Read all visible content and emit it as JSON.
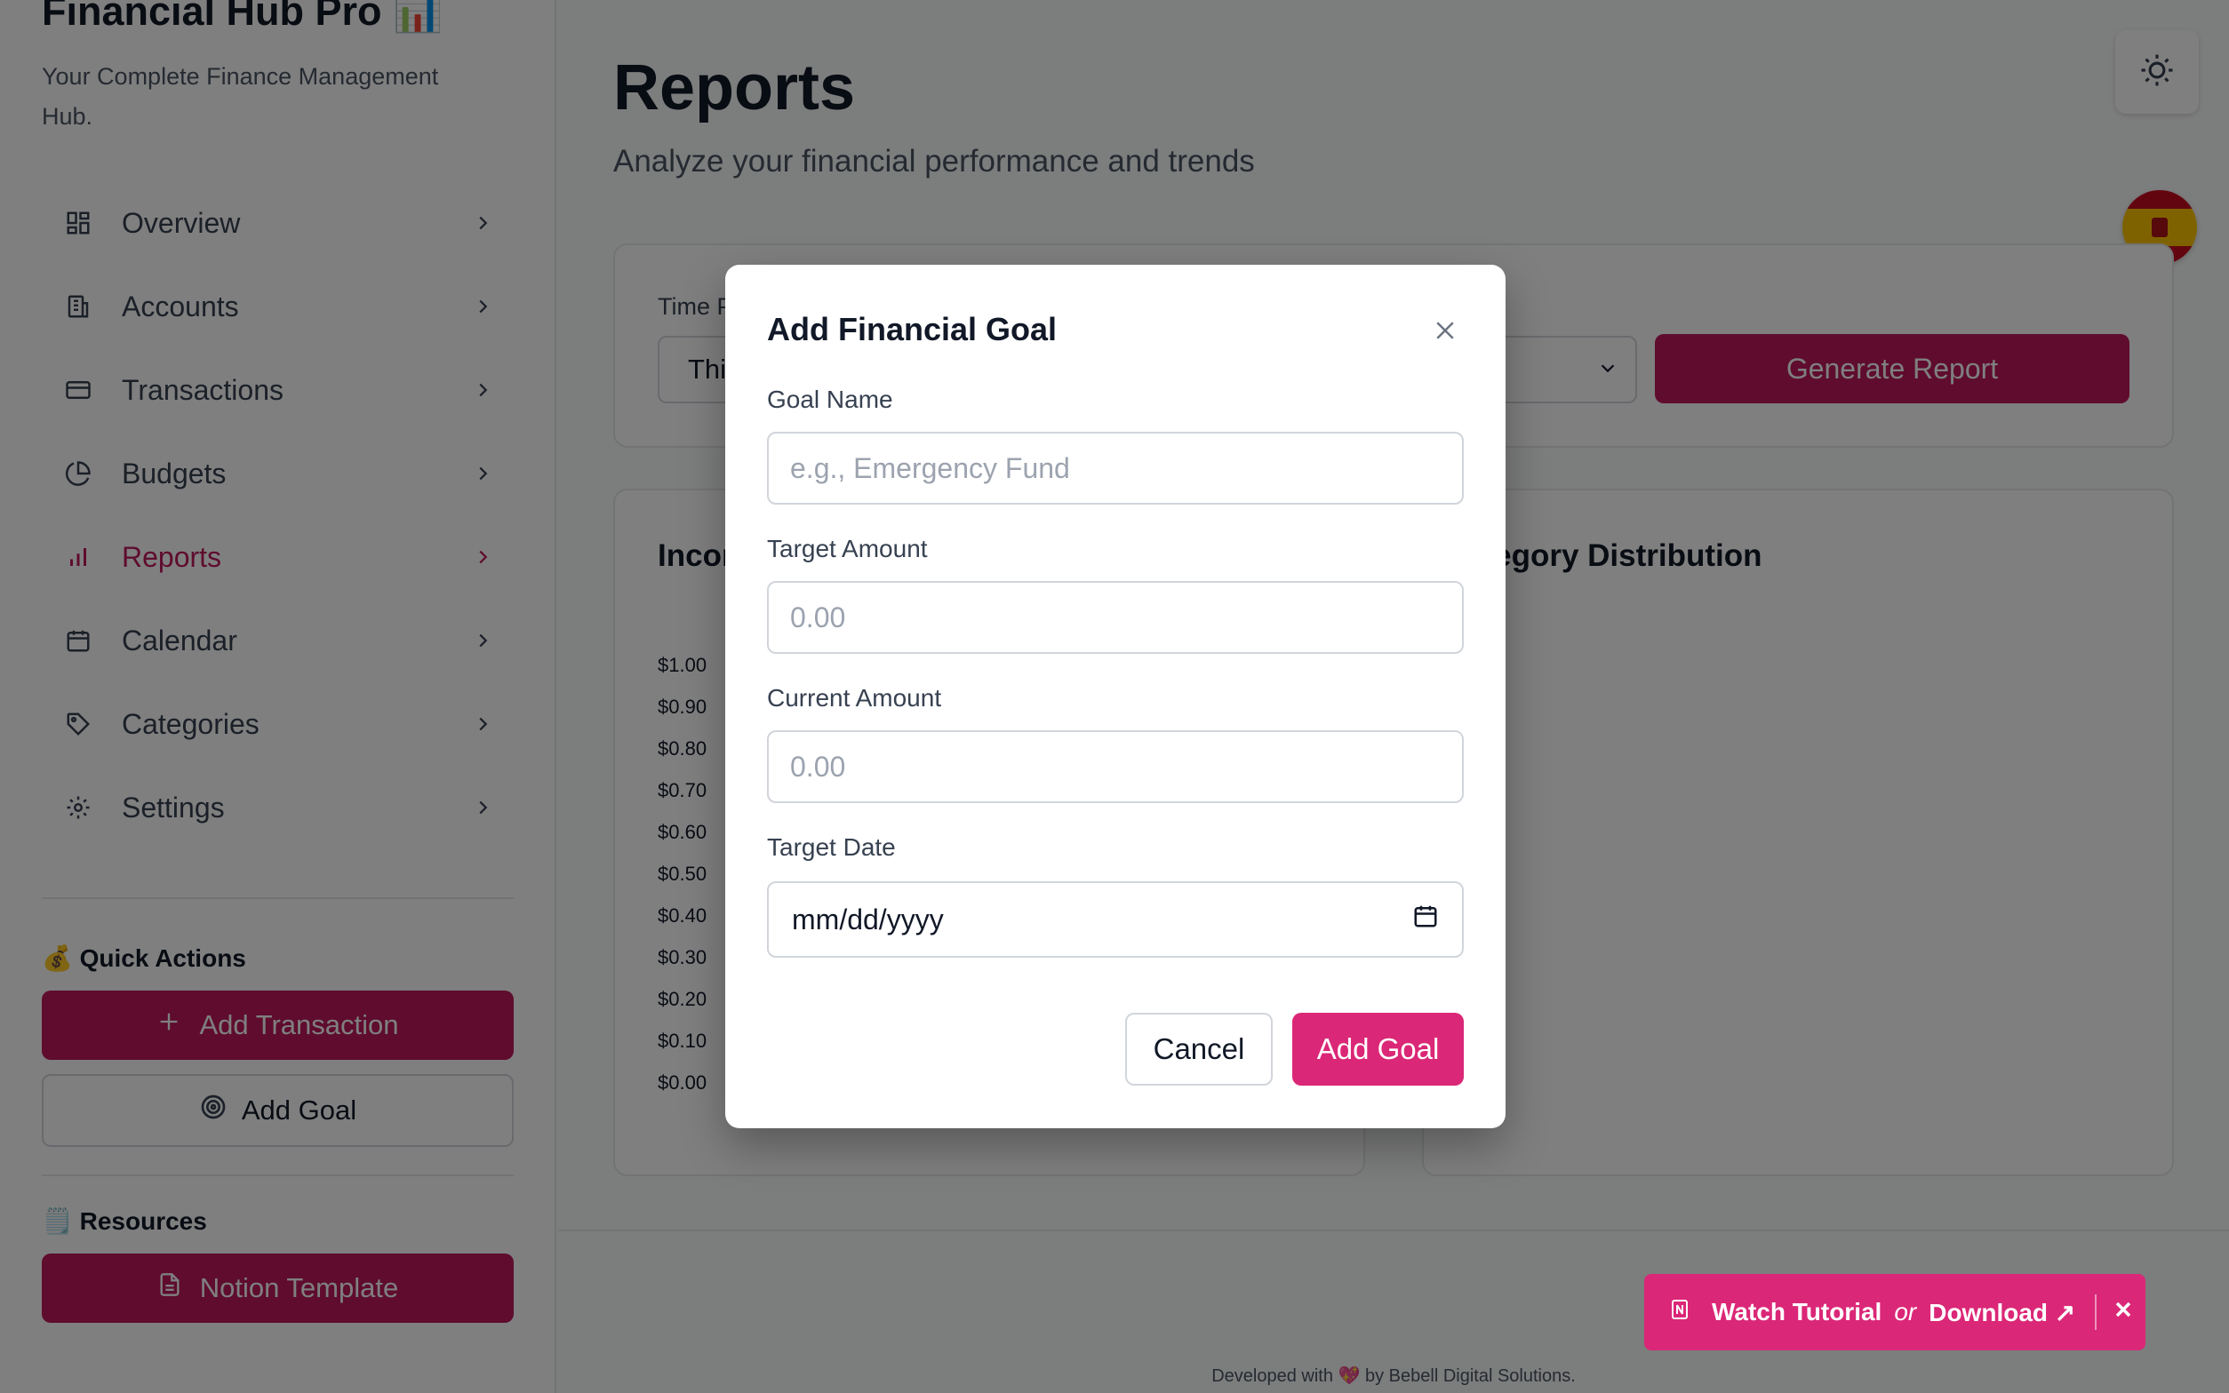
{
  "app": {
    "title": "Financial Hub Pro 📊",
    "subtitle": "Your Complete Finance Management Hub."
  },
  "nav": {
    "items": [
      {
        "label": "Overview",
        "icon": "layout-grid-icon"
      },
      {
        "label": "Accounts",
        "icon": "building-icon"
      },
      {
        "label": "Transactions",
        "icon": "credit-card-icon"
      },
      {
        "label": "Budgets",
        "icon": "pie-chart-icon"
      },
      {
        "label": "Reports",
        "icon": "bar-chart-icon",
        "active": true
      },
      {
        "label": "Calendar",
        "icon": "calendar-icon"
      },
      {
        "label": "Categories",
        "icon": "tag-icon"
      },
      {
        "label": "Settings",
        "icon": "gear-icon"
      }
    ]
  },
  "quick_actions": {
    "title": "💰 Quick Actions",
    "add_transaction": "Add Transaction",
    "add_goal": "Add Goal"
  },
  "resources": {
    "title": "🗒️ Resources",
    "notion_template": "Notion Template"
  },
  "page": {
    "title": "Reports",
    "subtitle": "Analyze your financial performance and trends"
  },
  "filters": {
    "time_label": "Time P",
    "time_value": "Thi",
    "generate_button": "Generate Report"
  },
  "income_chart": {
    "title": "Incom",
    "yticks": [
      "$1.00",
      "$0.90",
      "$0.80",
      "$0.70",
      "$0.60",
      "$0.50",
      "$0.40",
      "$0.30",
      "$0.20",
      "$0.10",
      "$0.00"
    ]
  },
  "category_chart": {
    "title": "ategory Distribution"
  },
  "modal": {
    "title": "Add Financial Goal",
    "goal_name_label": "Goal Name",
    "goal_name_placeholder": "e.g., Emergency Fund",
    "target_amount_label": "Target Amount",
    "target_amount_placeholder": "0.00",
    "current_amount_label": "Current Amount",
    "current_amount_placeholder": "0.00",
    "target_date_label": "Target Date",
    "target_date_placeholder": "mm/dd/yyyy",
    "cancel_button": "Cancel",
    "add_button": "Add Goal"
  },
  "tutorial": {
    "watch": "Watch Tutorial",
    "or": "or",
    "download": "Download ↗"
  },
  "footer": {
    "text": "Developed with 💖 by Bebell Digital Solutions."
  },
  "colors": {
    "brand": "#be185d",
    "accent": "#db2777",
    "overlay": "rgba(0,0,0,0.5)"
  }
}
